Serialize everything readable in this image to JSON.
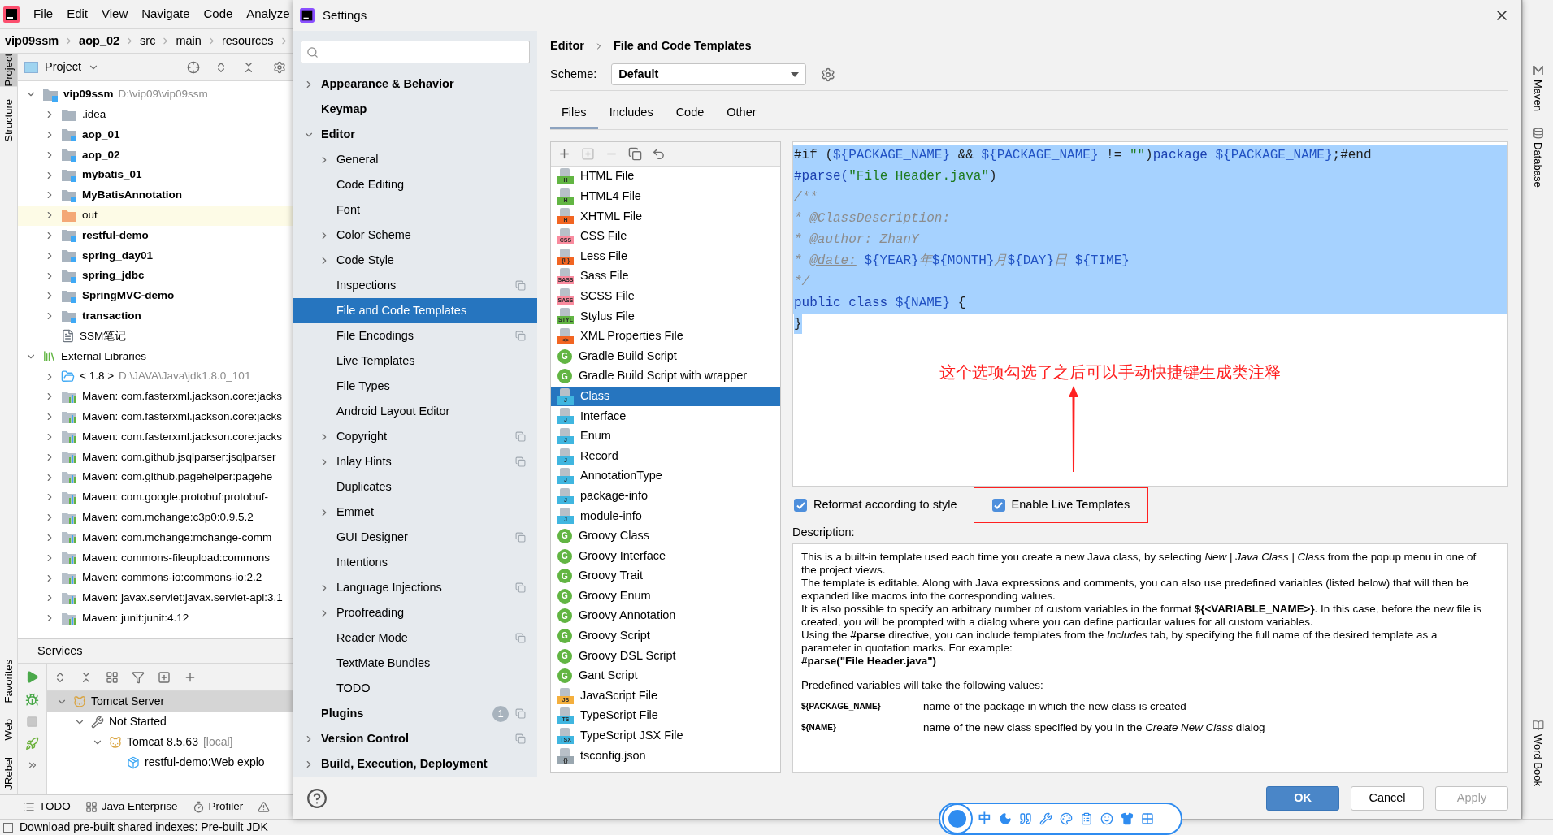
{
  "menu": [
    "File",
    "Edit",
    "View",
    "Navigate",
    "Code",
    "Analyze"
  ],
  "breadcrumb": [
    "vip09ssm",
    "aop_02",
    "src",
    "main",
    "resources"
  ],
  "left_tool_tabs_top": [
    {
      "label": "Project",
      "selected": true
    },
    {
      "label": "Structure",
      "selected": false
    }
  ],
  "left_tool_tabs_bottom": [
    {
      "label": "Favorites",
      "selected": false
    },
    {
      "label": "Web",
      "selected": false
    },
    {
      "label": "JRebel",
      "selected": false
    }
  ],
  "project_panel": {
    "title": "Project",
    "tree": [
      {
        "label": "vip09ssm",
        "path": "D:\\vip09\\vip09ssm",
        "kind": "module",
        "expanded": true,
        "children": [
          {
            "label": ".idea",
            "kind": "folder"
          },
          {
            "label": "aop_01",
            "kind": "module"
          },
          {
            "label": "aop_02",
            "kind": "module"
          },
          {
            "label": "mybatis_01",
            "kind": "module"
          },
          {
            "label": "MyBatisAnnotation",
            "kind": "module"
          },
          {
            "label": "out",
            "kind": "excluded"
          },
          {
            "label": "restful-demo",
            "kind": "module"
          },
          {
            "label": "spring_day01",
            "kind": "module"
          },
          {
            "label": "spring_jdbc",
            "kind": "module"
          },
          {
            "label": "SpringMVC-demo",
            "kind": "module"
          },
          {
            "label": "transaction",
            "kind": "module"
          },
          {
            "label": "SSM笔记",
            "kind": "file"
          }
        ]
      },
      {
        "label": "External Libraries",
        "kind": "libraries",
        "expanded": true,
        "children": [
          {
            "label": "< 1.8 >",
            "path": "D:\\JAVA\\Java\\jdk1.8.0_101",
            "kind": "jdk"
          },
          {
            "label": "Maven: com.fasterxml.jackson.core:jacks",
            "kind": "library"
          },
          {
            "label": "Maven: com.fasterxml.jackson.core:jacks",
            "kind": "library"
          },
          {
            "label": "Maven: com.fasterxml.jackson.core:jacks",
            "kind": "library"
          },
          {
            "label": "Maven: com.github.jsqlparser:jsqlparser",
            "kind": "library"
          },
          {
            "label": "Maven: com.github.pagehelper:pagehe",
            "kind": "library"
          },
          {
            "label": "Maven: com.google.protobuf:protobuf-",
            "kind": "library"
          },
          {
            "label": "Maven: com.mchange:c3p0:0.9.5.2",
            "kind": "library"
          },
          {
            "label": "Maven: com.mchange:mchange-comm",
            "kind": "library"
          },
          {
            "label": "Maven: commons-fileupload:commons",
            "kind": "library"
          },
          {
            "label": "Maven: commons-io:commons-io:2.2",
            "kind": "library"
          },
          {
            "label": "Maven: javax.servlet:javax.servlet-api:3.1",
            "kind": "library"
          },
          {
            "label": "Maven: junit:junit:4.12",
            "kind": "library"
          }
        ]
      }
    ]
  },
  "services": {
    "title": "Services",
    "tree": [
      {
        "label": "Tomcat Server",
        "kind": "tomcat",
        "selected": true,
        "expanded": true,
        "children": [
          {
            "label": "Not Started",
            "kind": "status",
            "selected": false,
            "expanded": true,
            "children": [
              {
                "label": "Tomcat 8.5.63",
                "note": "[local]",
                "kind": "tomcat",
                "selected": false,
                "expanded": true,
                "children": [
                  {
                    "label": "restful-demo:Web explo",
                    "kind": "artifact",
                    "selected": false
                  }
                ]
              }
            ]
          }
        ]
      }
    ]
  },
  "bottom_tools": [
    {
      "label": "TODO",
      "kind": "list"
    },
    {
      "label": "Java Enterprise",
      "kind": "enterprise"
    },
    {
      "label": "Profiler",
      "kind": "profiler"
    }
  ],
  "status_bar": "Download pre-built shared indexes: Pre-built JDK",
  "right_tool_tabs_top": [
    {
      "label": "Maven",
      "kind": "maven"
    },
    {
      "label": "Database",
      "kind": "database"
    }
  ],
  "right_tool_tabs_bottom": [
    {
      "label": "Word Book",
      "kind": "book"
    }
  ],
  "dialog": {
    "title": "Settings",
    "settings_tree": [
      {
        "label": "Appearance & Behavior",
        "expandable": true,
        "selected": false,
        "project_level": false
      },
      {
        "label": "Keymap",
        "expandable": false,
        "selected": false,
        "project_level": false
      },
      {
        "label": "Editor",
        "expandable": true,
        "expanded": true,
        "selected": false,
        "project_level": false,
        "children": [
          {
            "label": "General",
            "expandable": true,
            "selected": false,
            "project_level": false
          },
          {
            "label": "Code Editing",
            "expandable": false,
            "selected": false,
            "project_level": false
          },
          {
            "label": "Font",
            "expandable": false,
            "selected": false,
            "project_level": false
          },
          {
            "label": "Color Scheme",
            "expandable": true,
            "selected": false,
            "project_level": false
          },
          {
            "label": "Code Style",
            "expandable": true,
            "selected": false,
            "project_level": false
          },
          {
            "label": "Inspections",
            "expandable": false,
            "selected": false,
            "project_level": true
          },
          {
            "label": "File and Code Templates",
            "expandable": false,
            "selected": true,
            "project_level": false
          },
          {
            "label": "File Encodings",
            "expandable": false,
            "selected": false,
            "project_level": true
          },
          {
            "label": "Live Templates",
            "expandable": false,
            "selected": false,
            "project_level": false
          },
          {
            "label": "File Types",
            "expandable": false,
            "selected": false,
            "project_level": false
          },
          {
            "label": "Android Layout Editor",
            "expandable": false,
            "selected": false,
            "project_level": false
          },
          {
            "label": "Copyright",
            "expandable": true,
            "selected": false,
            "project_level": true
          },
          {
            "label": "Inlay Hints",
            "expandable": true,
            "selected": false,
            "project_level": true
          },
          {
            "label": "Duplicates",
            "expandable": false,
            "selected": false,
            "project_level": false
          },
          {
            "label": "Emmet",
            "expandable": true,
            "selected": false,
            "project_level": false
          },
          {
            "label": "GUI Designer",
            "expandable": false,
            "selected": false,
            "project_level": true
          },
          {
            "label": "Intentions",
            "expandable": false,
            "selected": false,
            "project_level": false
          },
          {
            "label": "Language Injections",
            "expandable": true,
            "selected": false,
            "project_level": true
          },
          {
            "label": "Proofreading",
            "expandable": true,
            "selected": false,
            "project_level": false
          },
          {
            "label": "Reader Mode",
            "expandable": false,
            "selected": false,
            "project_level": true
          },
          {
            "label": "TextMate Bundles",
            "expandable": false,
            "selected": false,
            "project_level": false
          },
          {
            "label": "TODO",
            "expandable": false,
            "selected": false,
            "project_level": false
          }
        ]
      },
      {
        "label": "Plugins",
        "expandable": false,
        "selected": false,
        "project_level": true,
        "badge": "1"
      },
      {
        "label": "Version Control",
        "expandable": true,
        "selected": false,
        "project_level": true
      },
      {
        "label": "Build, Execution, Deployment",
        "expandable": true,
        "selected": false,
        "project_level": false
      }
    ],
    "breadcrumb": [
      "Editor",
      "File and Code Templates"
    ],
    "scheme": {
      "label": "Scheme:",
      "value": "Default"
    },
    "tabs": [
      {
        "label": "Files",
        "selected": true
      },
      {
        "label": "Includes",
        "selected": false
      },
      {
        "label": "Code",
        "selected": false
      },
      {
        "label": "Other",
        "selected": false
      }
    ],
    "toolbar": [
      {
        "kind": "add",
        "disabled": false
      },
      {
        "kind": "add-child",
        "disabled": true
      },
      {
        "kind": "remove",
        "disabled": true
      },
      {
        "kind": "copy",
        "disabled": false
      },
      {
        "kind": "reset",
        "disabled": false
      }
    ],
    "templates": [
      {
        "label": "HTML File",
        "kind": "file",
        "badge": "H",
        "color": "#62b543",
        "selected": false
      },
      {
        "label": "HTML4 File",
        "kind": "file",
        "badge": "H",
        "color": "#62b543",
        "selected": false
      },
      {
        "label": "XHTML File",
        "kind": "file",
        "badge": "H",
        "color": "#f26522",
        "selected": false
      },
      {
        "label": "CSS File",
        "kind": "file",
        "badge": "CSS",
        "color": "#f98b9e",
        "selected": false
      },
      {
        "label": "Less File",
        "kind": "file",
        "badge": "{L}",
        "color": "#f26522",
        "selected": false
      },
      {
        "label": "Sass File",
        "kind": "file",
        "badge": "SASS",
        "color": "#f98b9e",
        "selected": false
      },
      {
        "label": "SCSS File",
        "kind": "file",
        "badge": "SASS",
        "color": "#f98b9e",
        "selected": false
      },
      {
        "label": "Stylus File",
        "kind": "file",
        "badge": "STYL",
        "color": "#62b543",
        "selected": false
      },
      {
        "label": "XML Properties File",
        "kind": "file",
        "badge": "<>",
        "color": "#f26522",
        "selected": false
      },
      {
        "label": "Gradle Build Script",
        "kind": "circle",
        "badge": "G",
        "color": "#62b543",
        "selected": false
      },
      {
        "label": "Gradle Build Script with wrapper",
        "kind": "circle",
        "badge": "G",
        "color": "#62b543",
        "selected": false
      },
      {
        "label": "Class",
        "kind": "file",
        "badge": "J",
        "color": "#40b6e0",
        "selected": true
      },
      {
        "label": "Interface",
        "kind": "file",
        "badge": "J",
        "color": "#40b6e0",
        "selected": false
      },
      {
        "label": "Enum",
        "kind": "file",
        "badge": "J",
        "color": "#40b6e0",
        "selected": false
      },
      {
        "label": "Record",
        "kind": "file",
        "badge": "J",
        "color": "#40b6e0",
        "selected": false
      },
      {
        "label": "AnnotationType",
        "kind": "file",
        "badge": "J",
        "color": "#40b6e0",
        "selected": false
      },
      {
        "label": "package-info",
        "kind": "file",
        "badge": "J",
        "color": "#40b6e0",
        "selected": false
      },
      {
        "label": "module-info",
        "kind": "file",
        "badge": "J",
        "color": "#40b6e0",
        "selected": false
      },
      {
        "label": "Groovy Class",
        "kind": "circle",
        "badge": "G",
        "color": "#62b543",
        "selected": false
      },
      {
        "label": "Groovy Interface",
        "kind": "circle",
        "badge": "G",
        "color": "#62b543",
        "selected": false
      },
      {
        "label": "Groovy Trait",
        "kind": "circle",
        "badge": "G",
        "color": "#62b543",
        "selected": false
      },
      {
        "label": "Groovy Enum",
        "kind": "circle",
        "badge": "G",
        "color": "#62b543",
        "selected": false
      },
      {
        "label": "Groovy Annotation",
        "kind": "circle",
        "badge": "G",
        "color": "#62b543",
        "selected": false
      },
      {
        "label": "Groovy Script",
        "kind": "circle",
        "badge": "G",
        "color": "#62b543",
        "selected": false
      },
      {
        "label": "Groovy DSL Script",
        "kind": "circle",
        "badge": "G",
        "color": "#62b543",
        "selected": false
      },
      {
        "label": "Gant Script",
        "kind": "circle",
        "badge": "G",
        "color": "#62b543",
        "selected": false
      },
      {
        "label": "JavaScript File",
        "kind": "file",
        "badge": "JS",
        "color": "#f4af3d",
        "selected": false
      },
      {
        "label": "TypeScript File",
        "kind": "file",
        "badge": "TS",
        "color": "#40b6e0",
        "selected": false
      },
      {
        "label": "TypeScript JSX File",
        "kind": "file",
        "badge": "TSX",
        "color": "#40b6e0",
        "selected": false
      },
      {
        "label": "tsconfig.json",
        "kind": "file",
        "badge": "{}",
        "color": "#9aa7b0",
        "selected": false
      }
    ],
    "code": [
      {
        "selected": true,
        "tokens": [
          {
            "kind": "plain",
            "text": "#if ("
          },
          {
            "kind": "var",
            "text": "${PACKAGE_NAME}"
          },
          {
            "kind": "plain",
            "text": " && "
          },
          {
            "kind": "var",
            "text": "${PACKAGE_NAME}"
          },
          {
            "kind": "plain",
            "text": " != "
          },
          {
            "kind": "string",
            "text": "\"\""
          },
          {
            "kind": "plain",
            "text": ")"
          },
          {
            "kind": "keyword",
            "text": "package "
          },
          {
            "kind": "var",
            "text": "${PACKAGE_NAME}"
          },
          {
            "kind": "plain",
            "text": ";#end"
          }
        ]
      },
      {
        "selected": true,
        "tokens": [
          {
            "kind": "keyword",
            "text": "#parse("
          },
          {
            "kind": "string",
            "text": "\"File Header.java\""
          },
          {
            "kind": "plain",
            "text": ")"
          }
        ]
      },
      {
        "selected": true,
        "tokens": [
          {
            "kind": "comment",
            "text": "/**"
          }
        ]
      },
      {
        "selected": true,
        "tokens": [
          {
            "kind": "comment",
            "text": "* "
          },
          {
            "kind": "doctag",
            "text": "@ClassDescription:"
          }
        ]
      },
      {
        "selected": true,
        "tokens": [
          {
            "kind": "comment",
            "text": "* "
          },
          {
            "kind": "doctag",
            "text": "@author:"
          },
          {
            "kind": "comment",
            "text": " ZhanY"
          }
        ]
      },
      {
        "selected": true,
        "tokens": [
          {
            "kind": "comment",
            "text": "* "
          },
          {
            "kind": "doctag",
            "text": "@date:"
          },
          {
            "kind": "var",
            "text": " ${YEAR}"
          },
          {
            "kind": "comment",
            "text": "年"
          },
          {
            "kind": "var",
            "text": "${MONTH}"
          },
          {
            "kind": "comment",
            "text": "月"
          },
          {
            "kind": "var",
            "text": "${DAY}"
          },
          {
            "kind": "comment",
            "text": "日"
          },
          {
            "kind": "var",
            "text": " ${TIME}"
          }
        ]
      },
      {
        "selected": true,
        "tokens": [
          {
            "kind": "comment",
            "text": "*/"
          }
        ]
      },
      {
        "selected": true,
        "tokens": [
          {
            "kind": "keyword",
            "text": "public class "
          },
          {
            "kind": "var",
            "text": "${NAME}"
          },
          {
            "kind": "plain",
            "text": " {"
          }
        ]
      },
      {
        "selected": true,
        "tokens": [
          {
            "kind": "plain",
            "text": "}"
          }
        ]
      }
    ],
    "annotation": "这个选项勾选了之后可以手动快捷键生成类注释",
    "options": [
      {
        "label": "Reformat according to style",
        "checked": true,
        "highlighted": false
      },
      {
        "label": "Enable Live Templates",
        "checked": true,
        "highlighted": true
      }
    ],
    "description_label": "Description:",
    "description": [
      "This is a built-in template used each time you create a new Java class, by selecting *New* | *Java Class* | *Class* from the popup menu in one of the project views.",
      "The template is editable. Along with Java expressions and comments, you can also use predefined variables (listed below) that will then be expanded like macros into the corresponding values.",
      "It is also possible to specify an arbitrary number of custom variables in the format **${<VARIABLE_NAME>}**. In this case, before the new file is created, you will be prompted with a dialog where you can define particular values for all custom variables.",
      "Using the **#parse** directive, you can include templates from the *Includes* tab, by specifying the full name of the desired template as a parameter in quotation marks. For example:"
    ],
    "example": "#parse(\"File Header.java\")",
    "variables_intro": "Predefined variables will take the following values:",
    "variables": [
      {
        "name": "${PACKAGE_NAME}",
        "meaning": "name of the package in which the new class is created"
      },
      {
        "name": "${NAME}",
        "meaning": "name of the new class specified by you in the *Create New Class* dialog"
      }
    ],
    "buttons": [
      {
        "label": "OK",
        "kind": "primary",
        "disabled": false
      },
      {
        "label": "Cancel",
        "kind": "normal",
        "disabled": false
      },
      {
        "label": "Apply",
        "kind": "normal",
        "disabled": true
      }
    ]
  },
  "ime_toolbar": {
    "mode": "中"
  }
}
